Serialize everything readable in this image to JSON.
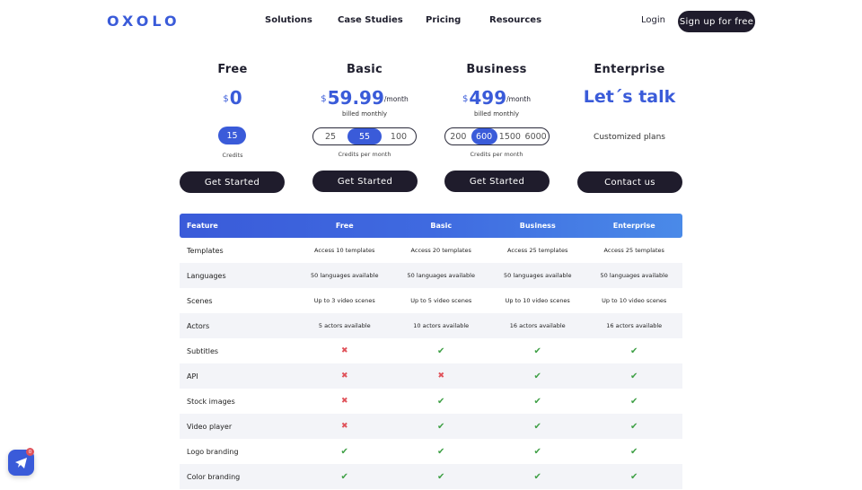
{
  "brand": {
    "logo": "OXOLO",
    "accent": "#3a5bd9",
    "dark": "#1f1c2c"
  },
  "nav": {
    "links": [
      "Solutions",
      "Case Studies",
      "Pricing",
      "Resources"
    ],
    "login": "Login",
    "signup": "Sign up for free"
  },
  "plans": [
    {
      "name": "Free",
      "currency": "$",
      "amount": "0",
      "per": "",
      "billed": "",
      "credits_options": [
        "15"
      ],
      "credits_selected": "15",
      "credits_label": "Credits",
      "cta": "Get Started"
    },
    {
      "name": "Basic",
      "currency": "$",
      "amount": "59.99",
      "per": "/month",
      "billed": "billed monthly",
      "credits_options": [
        "25",
        "55",
        "100"
      ],
      "credits_selected": "55",
      "credits_label": "Credits per month",
      "cta": "Get Started"
    },
    {
      "name": "Business",
      "currency": "$",
      "amount": "499",
      "per": "/month",
      "billed": "billed monthly",
      "credits_options": [
        "200",
        "600",
        "1500",
        "6000"
      ],
      "credits_selected": "600",
      "credits_label": "Credits per month",
      "cta": "Get Started"
    },
    {
      "name": "Enterprise",
      "headline": "Let´s talk",
      "subtext": "Customized plans",
      "cta": "Contact us"
    }
  ],
  "table": {
    "headers": [
      "Feature",
      "Free",
      "Basic",
      "Business",
      "Enterprise"
    ],
    "rows": [
      {
        "feature": "Templates",
        "values": [
          "Access 10 templates",
          "Access 20 templates",
          "Access 25 templates",
          "Access 25 templates"
        ]
      },
      {
        "feature": "Languages",
        "values": [
          "50 languages available",
          "50 languages available",
          "50 languages available",
          "50 languages available"
        ]
      },
      {
        "feature": "Scenes",
        "values": [
          "Up to 3 video scenes",
          "Up to 5 video scenes",
          "Up to 10 video scenes",
          "Up to 10 video scenes"
        ]
      },
      {
        "feature": "Actors",
        "values": [
          "5 actors available",
          "10 actors available",
          "16 actors available",
          "16 actors available"
        ]
      },
      {
        "feature": "Subtitles",
        "values": [
          "cross",
          "check",
          "check",
          "check"
        ]
      },
      {
        "feature": "API",
        "values": [
          "cross",
          "cross",
          "check",
          "check"
        ]
      },
      {
        "feature": "Stock images",
        "values": [
          "cross",
          "check",
          "check",
          "check"
        ]
      },
      {
        "feature": "Video player",
        "values": [
          "cross",
          "check",
          "check",
          "check"
        ]
      },
      {
        "feature": "Logo branding",
        "values": [
          "check",
          "check",
          "check",
          "check"
        ]
      },
      {
        "feature": "Color branding",
        "values": [
          "check",
          "check",
          "check",
          "check"
        ]
      }
    ]
  },
  "chat_widget": {
    "badge": "0",
    "icon": "chat-icon"
  }
}
